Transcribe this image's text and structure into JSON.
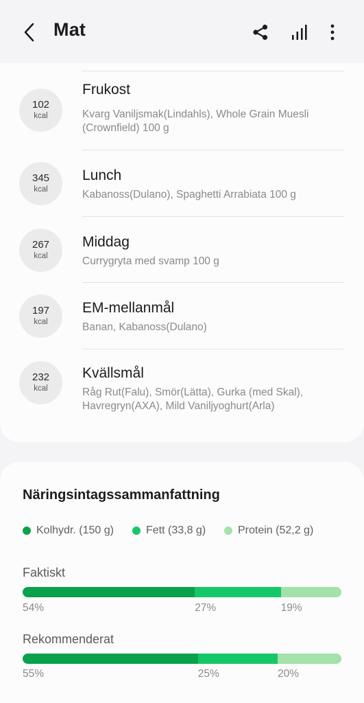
{
  "header": {
    "title": "Mat",
    "icons": [
      "back-icon",
      "share-icon",
      "chart-bars-icon",
      "more-vertical-icon"
    ]
  },
  "meals": [
    {
      "kcal": "102",
      "unit": "kcal",
      "name": "Frukost",
      "desc": "Kvarg Vaniljsmak(Lindahls), Whole Grain Muesli (Crownfield) 100 g"
    },
    {
      "kcal": "345",
      "unit": "kcal",
      "name": "Lunch",
      "desc": "Kabanoss(Dulano), Spaghetti Arrabiata 100 g"
    },
    {
      "kcal": "267",
      "unit": "kcal",
      "name": "Middag",
      "desc": "Currygryta med svamp 100 g"
    },
    {
      "kcal": "197",
      "unit": "kcal",
      "name": "EM-mellanmål",
      "desc": "Banan, Kabanoss(Dulano)"
    },
    {
      "kcal": "232",
      "unit": "kcal",
      "name": "Kvällsmål",
      "desc": "Råg Rut(Falu), Smör(Lätta), Gurka (med Skal), Havregryn(AXA), Mild Vaniljyoghurt(Arla)"
    }
  ],
  "nutrition": {
    "title": "Näringsintagssammanfattning",
    "legend": [
      {
        "label": "Kolhydr. (150 g)",
        "color": "#0aa14d"
      },
      {
        "label": "Fett (33,8 g)",
        "color": "#15c766"
      },
      {
        "label": "Protein (52,2 g)",
        "color": "#a3e2a9"
      }
    ],
    "actual": {
      "label": "Faktiskt",
      "values": [
        54,
        27,
        19
      ],
      "labels": [
        "54%",
        "27%",
        "19%"
      ]
    },
    "recommended": {
      "label": "Rekommenderat",
      "values": [
        55,
        25,
        20
      ],
      "labels": [
        "55%",
        "25%",
        "20%"
      ]
    }
  }
}
